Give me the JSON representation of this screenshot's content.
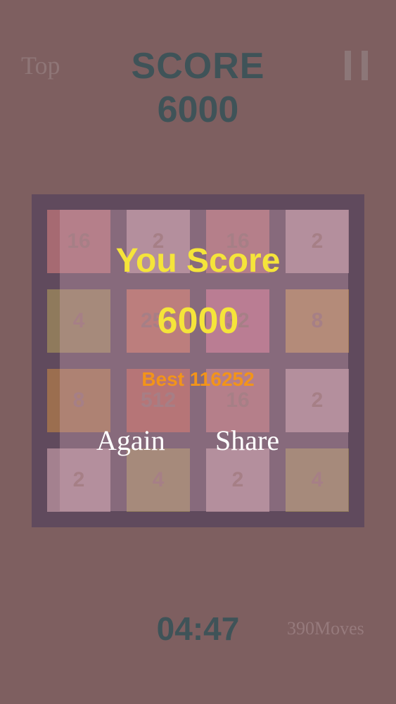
{
  "header": {
    "top_label": "Top",
    "score_label": "SCORE",
    "score_value": "6000",
    "pause_icon": "pause-icon"
  },
  "board": {
    "rows": [
      [
        {
          "value": "16",
          "color": "#a66a72"
        },
        {
          "value": "2",
          "color": "#a4818f"
        },
        {
          "value": "16",
          "color": "#a66a72"
        },
        {
          "value": "2",
          "color": "#a4818f"
        }
      ],
      [
        {
          "value": "4",
          "color": "#8f7a5c"
        },
        {
          "value": "256",
          "color": "#b0685e"
        },
        {
          "value": "32",
          "color": "#ad6780"
        },
        {
          "value": "8",
          "color": "#a47c58"
        }
      ],
      [
        {
          "value": "8",
          "color": "#9b6e4f"
        },
        {
          "value": "512",
          "color": "#a75a56"
        },
        {
          "value": "16",
          "color": "#a66a72"
        },
        {
          "value": "2",
          "color": "#a4818f"
        }
      ],
      [
        {
          "value": "2",
          "color": "#a4818f"
        },
        {
          "value": "4",
          "color": "#8f7a5c"
        },
        {
          "value": "2",
          "color": "#a4818f"
        },
        {
          "value": "4",
          "color": "#8f7a5c"
        }
      ]
    ]
  },
  "game_over": {
    "title": "You Score",
    "score": "6000",
    "best": "Best 116252",
    "again_label": "Again",
    "share_label": "Share"
  },
  "footer": {
    "timer": "04:47",
    "moves": "390Moves"
  },
  "colors": {
    "background": "#7e5f60",
    "board": "#604a5d",
    "highlight_yellow": "#f5e43a",
    "best_orange": "#f2941a"
  }
}
